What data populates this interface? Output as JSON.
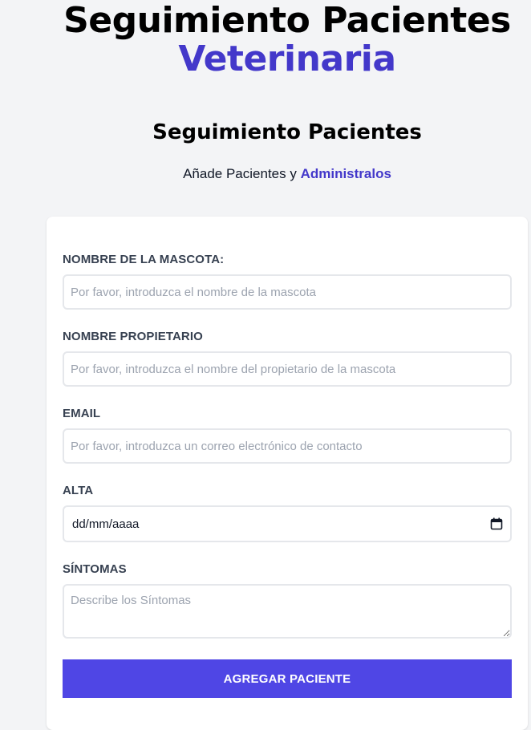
{
  "header": {
    "title_main": "Seguimiento Pacientes",
    "title_accent": "Veterinaria"
  },
  "section": {
    "title": "Seguimiento Pacientes",
    "subtitle_prefix": "Añade Pacientes y ",
    "subtitle_accent": "Administralos"
  },
  "form": {
    "pet_name": {
      "label": "NOMBRE DE LA MASCOTA:",
      "placeholder": "Por favor, introduzca el nombre de la mascota",
      "value": ""
    },
    "owner_name": {
      "label": "NOMBRE PROPIETARIO",
      "placeholder": "Por favor, introduzca el nombre del propietario de la mascota",
      "value": ""
    },
    "email": {
      "label": "EMAIL",
      "placeholder": "Por favor, introduzca un correo electrónico de contacto",
      "value": ""
    },
    "discharge": {
      "label": "ALTA",
      "value": "dd/mm/aaaa",
      "icon": "calendar-icon"
    },
    "symptoms": {
      "label": "SÍNTOMAS",
      "placeholder": "Describe los Síntomas",
      "value": ""
    },
    "submit_label": "AGREGAR PACIENTE"
  },
  "colors": {
    "background": "#f3f4f6",
    "accent_text": "#4338ca",
    "button": "#4f46e5",
    "label": "#374151",
    "input_border": "#e5e7eb",
    "placeholder": "#9ca3af"
  }
}
